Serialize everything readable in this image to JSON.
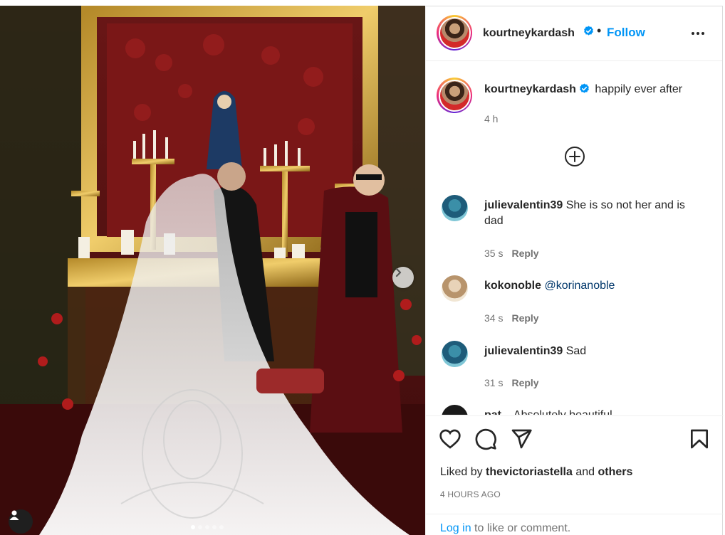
{
  "post": {
    "author": "kourtneykardash",
    "follow_label": "Follow",
    "separator": "•",
    "caption": "happily ever after",
    "caption_time": "4 h"
  },
  "comments": [
    {
      "user": "julievalentin39",
      "text": "She is so not her and is dad",
      "time": "35 s",
      "reply": "Reply"
    },
    {
      "user": "kokonoble",
      "mention": "@korinanoble",
      "time": "34 s",
      "reply": "Reply"
    },
    {
      "user": "julievalentin39",
      "text": "Sad",
      "time": "31 s",
      "reply": "Reply"
    }
  ],
  "partial_comment": {
    "user": "pat...",
    "text": "Absolutely beautiful ..."
  },
  "likes": {
    "prefix": "Liked by",
    "user": "thevictoriastella",
    "and": "and",
    "others": "others"
  },
  "posted_ago": "4 HOURS AGO",
  "login": {
    "link": "Log in",
    "rest": "to like or comment."
  },
  "carousel": {
    "slides": 5,
    "active": 0
  },
  "colors": {
    "link": "#0095f6",
    "verified": "#0095f6",
    "muted": "#737373",
    "text": "#262626"
  },
  "icons": [
    "heart-icon",
    "comment-icon",
    "share-icon",
    "bookmark-icon",
    "more-icon",
    "plus-circle-icon",
    "chevron-right-icon",
    "user-tag-icon",
    "verified-badge-icon"
  ]
}
